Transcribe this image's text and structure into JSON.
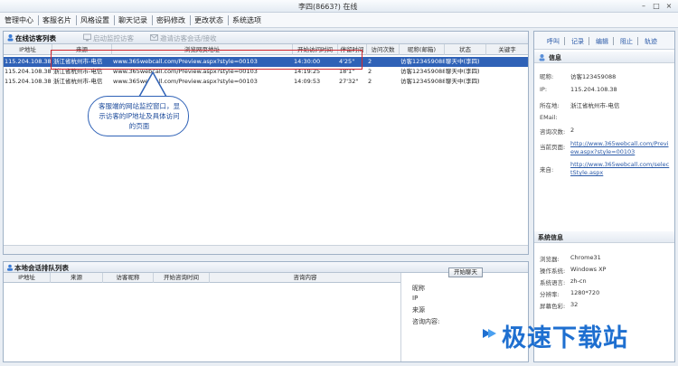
{
  "window": {
    "title": "李四(8663?) 在线"
  },
  "menu": [
    "管理中心",
    "客服名片",
    "风格设置",
    "聊天记录",
    "密码修改",
    "更改状态",
    "系统选项"
  ],
  "toolbar": {
    "online_list": "在线访客列表",
    "start_monitor": "启动监控访客",
    "invite": "邀请访客会话/接收"
  },
  "visitor_table": {
    "columns": [
      "IP地址",
      "来源",
      "浏览网页地址",
      "开始访问时间",
      "停留时间",
      "访问次数",
      "昵称(邮箱)",
      "状态",
      "关键字"
    ],
    "rows": [
      [
        "115.204.108.38",
        "浙江省杭州市-电信",
        "www.365webcall.com/Preview.aspx?style=00103",
        "14:30:00",
        "4'25\"",
        "2",
        "访客123459088",
        "聊天中(李四)",
        ""
      ],
      [
        "115.204.108.38",
        "浙江省杭州市-电信",
        "www.365webcall.com/Preview.aspx?style=00103",
        "14:19:25",
        "18'1\"",
        "2",
        "访客123459088",
        "聊天中(李四)",
        ""
      ],
      [
        "115.204.108.38",
        "浙江省杭州市-电信",
        "www.365webcall.com/Preview.aspx?style=00103",
        "14:09:53",
        "27'32\"",
        "2",
        "访客123459088",
        "聊天中(李四)",
        ""
      ]
    ]
  },
  "callout": {
    "text": "客服端的网站监控窗口，显示访客的IP地址及具体访问的页面"
  },
  "queue": {
    "title": "本地会话排队列表",
    "columns": [
      "IP地址",
      "来源",
      "访客昵称",
      "开始咨询时间",
      "咨询内容"
    ],
    "start_button": "开始聊天",
    "labels": [
      "昵称",
      "IP",
      "来源",
      "咨询内容:"
    ]
  },
  "right_tabs": [
    "呼叫",
    "记录",
    "编辑",
    "阻止",
    "轨迹"
  ],
  "visitor_info": {
    "section": "信息",
    "nick_label": "昵称:",
    "nick": "访客123459088",
    "ip_label": "IP:",
    "ip": "115.204.108.38",
    "loc_label": "所在地:",
    "loc": "浙江省杭州市-电信",
    "email_label": "EMail:",
    "visits_label": "咨询次数:",
    "visits": "2",
    "page_label": "当前页面:",
    "page": "http://www.365webcall.com/Preview.aspx?style=00103",
    "from_label": "来自:",
    "from": "http://www.365webcall.com/selectStyle.aspx"
  },
  "system_info": {
    "section": "系统信息",
    "browser_label": "浏览器:",
    "browser": "Chrome31",
    "os_label": "操作系统:",
    "os": "Windows XP",
    "lang_label": "系统语言:",
    "lang": "zh-cn",
    "res_label": "分辨率:",
    "res": "1280*720",
    "color_label": "屏幕色彩:",
    "color": "32"
  },
  "watermark": "极速下载站",
  "colors": {
    "selection": "#2f62b7",
    "highlight": "#d2282f",
    "link": "#2b5aa8",
    "watermark": "#1e6fd0"
  }
}
